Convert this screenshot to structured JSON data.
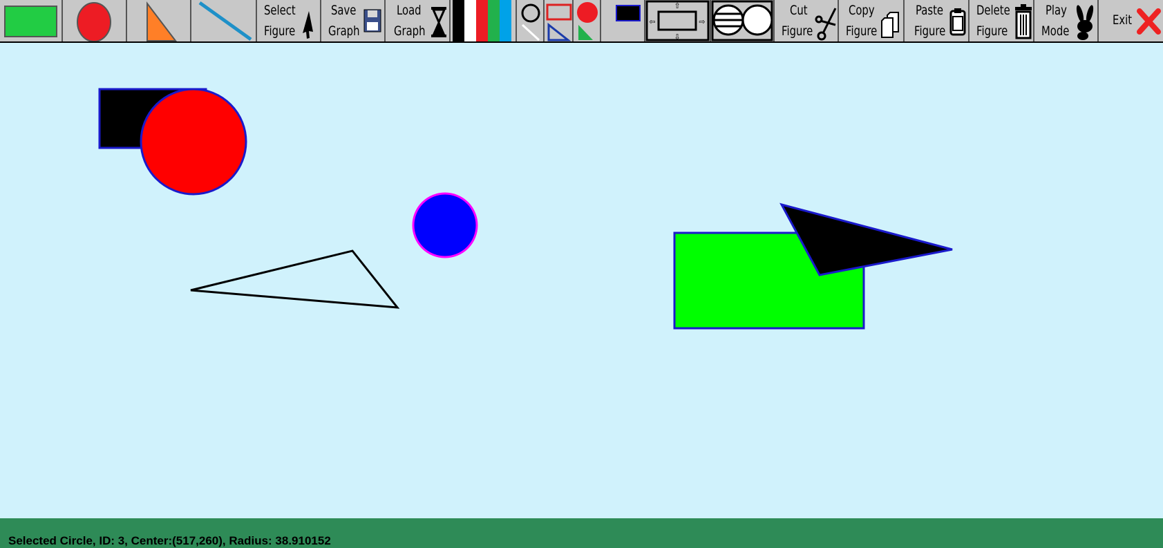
{
  "toolbar": {
    "select_figure": [
      "Select",
      "Figure"
    ],
    "save_graph": [
      "Save",
      "Graph"
    ],
    "load_graph": [
      "Load",
      "Graph"
    ],
    "cut_figure": [
      "Cut",
      "Figure"
    ],
    "copy_figure": [
      "Copy",
      "Figure"
    ],
    "paste_figure": [
      "Paste",
      "Figure"
    ],
    "delete_figure": [
      "Delete",
      "Figure"
    ],
    "play_mode": [
      "Play",
      "Mode"
    ],
    "exit": "Exit",
    "palette_colors": [
      "#000000",
      "#ffffff",
      "#ed1c24",
      "#22b14c",
      "#00a2e8"
    ]
  },
  "tools": {
    "rectangle": {
      "icon": "rectangle-icon",
      "color": "#22cc44"
    },
    "circle": {
      "icon": "circle-icon",
      "color": "#ed1c24"
    },
    "triangle": {
      "icon": "triangle-icon",
      "color": "#ff7f27"
    },
    "line": {
      "icon": "line-icon",
      "color": "#1e90c8"
    }
  },
  "canvas": {
    "background": "#d0f2fc",
    "shapes": [
      {
        "kind": "rectangle",
        "fill": "#000000",
        "stroke": "#1a1acc"
      },
      {
        "kind": "circle",
        "fill": "#ff0000",
        "stroke": "#1a1acc"
      },
      {
        "kind": "circle",
        "fill": "#0000ff",
        "stroke": "#ff00ff"
      },
      {
        "kind": "triangle",
        "fill": "none",
        "stroke": "#000000"
      },
      {
        "kind": "rectangle",
        "fill": "#00ff00",
        "stroke": "#1a1acc"
      },
      {
        "kind": "triangle",
        "fill": "#000000",
        "stroke": "#1a1acc"
      }
    ]
  },
  "status": {
    "text": "Selected Circle, ID: 3, Center:(517,260), Radius: 38.910152"
  }
}
